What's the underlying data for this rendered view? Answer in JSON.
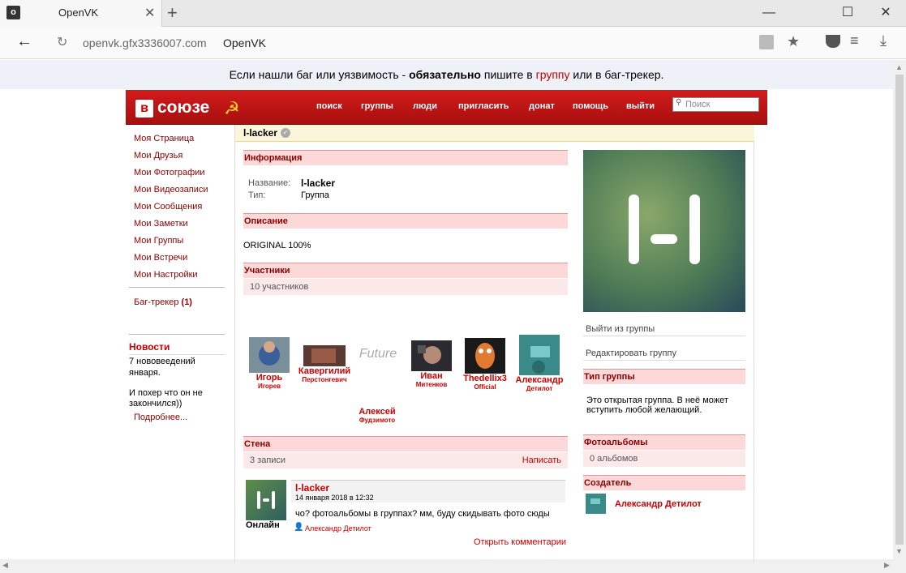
{
  "browser": {
    "tab_title": "OpenVK",
    "favicon_letter": "o",
    "url_host": "openvk.gfx3336007.com",
    "url_title": "OpenVK"
  },
  "notice": {
    "part1": "Если нашли баг или уязвимость - ",
    "bold": "обязательно",
    "part2": " пишите в ",
    "link": "группу",
    "part3": " или в баг-трекер."
  },
  "header": {
    "logo_letter": "в",
    "logo_text": "союзе",
    "nav": [
      "поиск",
      "группы",
      "люди",
      "пригласить",
      "донат",
      "помощь",
      "выйти"
    ],
    "search_placeholder": "Поиск"
  },
  "sidebar": {
    "items": [
      "Моя Страница",
      "Мои Друзья",
      "Мои Фотографии",
      "Мои Видеозаписи",
      "Мои Сообщения",
      "Мои Заметки",
      "Мои Группы",
      "Мои Встречи",
      "Мои Настройки"
    ],
    "bugtracker": "Баг-трекер",
    "bugtracker_count": "(1)",
    "news_title": "Новости",
    "news_line1": "7 нововеедений",
    "news_line2": "января.",
    "news_line3": "И похер что он не",
    "news_line4": "закончился))",
    "news_more": "Подробнее..."
  },
  "group": {
    "title": "l-lacker",
    "info_head": "Информация",
    "name_label": "Название:",
    "name_value": "l-lacker",
    "type_label": "Тип:",
    "type_value": "Группа",
    "desc_head": "Описание",
    "desc_text": "ORIGINAL 100%",
    "members_head": "Участники",
    "members_count": "10 участников",
    "members": [
      {
        "name": "Игорь",
        "sub": "Игорев"
      },
      {
        "name": "Кавергилий",
        "sub": "Перстонгевич"
      },
      {
        "name": "",
        "sub": "",
        "image_text": "Future"
      },
      {
        "name": "Иван",
        "sub": "Митенков"
      },
      {
        "name": "Thedellix3",
        "sub": "Official"
      },
      {
        "name": "Александр",
        "sub": "Детилот"
      },
      {
        "name": "Алексей",
        "sub": "Фудзимото"
      }
    ],
    "wall_head": "Стена",
    "wall_count": "3 записи",
    "wall_write": "Написать",
    "post": {
      "author": "l-lacker",
      "date": "14 января 2018 в 12:32",
      "online": "Онлайн",
      "text": "чо? фотоальбомы в группах? мм, буду скидывать фото сюды",
      "signed_by": "Александр Детилот",
      "comments_link": "Открыть комментарии"
    }
  },
  "right": {
    "leave": "Выйти из группы",
    "edit": "Редактировать группу",
    "type_head": "Тип группы",
    "type_text1": "Это открытая группа. В неё может",
    "type_text2": "вступить любой желающий.",
    "albums_head": "Фотоальбомы",
    "albums_count": "0 альбомов",
    "creator_head": "Создатель",
    "creator_name": "Александр Детилот"
  }
}
